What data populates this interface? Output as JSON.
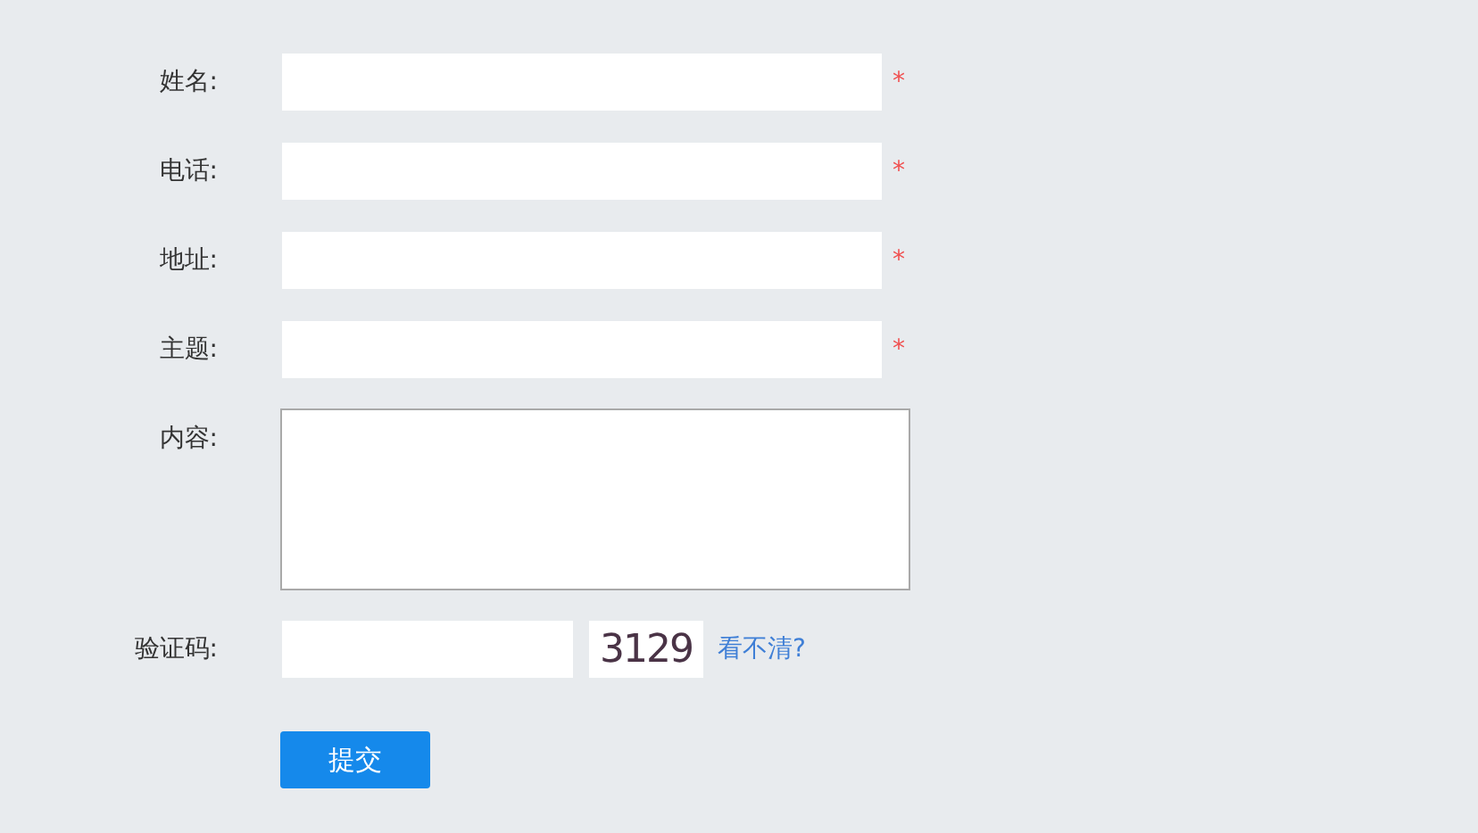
{
  "fields": [
    {
      "kind": "text",
      "label": "姓名:",
      "required_mark": "*"
    },
    {
      "kind": "text",
      "label": "电话:",
      "required_mark": "*"
    },
    {
      "kind": "text",
      "label": "地址:",
      "required_mark": "*"
    },
    {
      "kind": "text",
      "label": "主题:",
      "required_mark": "*"
    },
    {
      "kind": "textarea",
      "label": "内容:"
    },
    {
      "kind": "captcha",
      "label": "验证码:",
      "code": "3129",
      "refresh_link": "看不清?"
    }
  ],
  "submit": "提交"
}
